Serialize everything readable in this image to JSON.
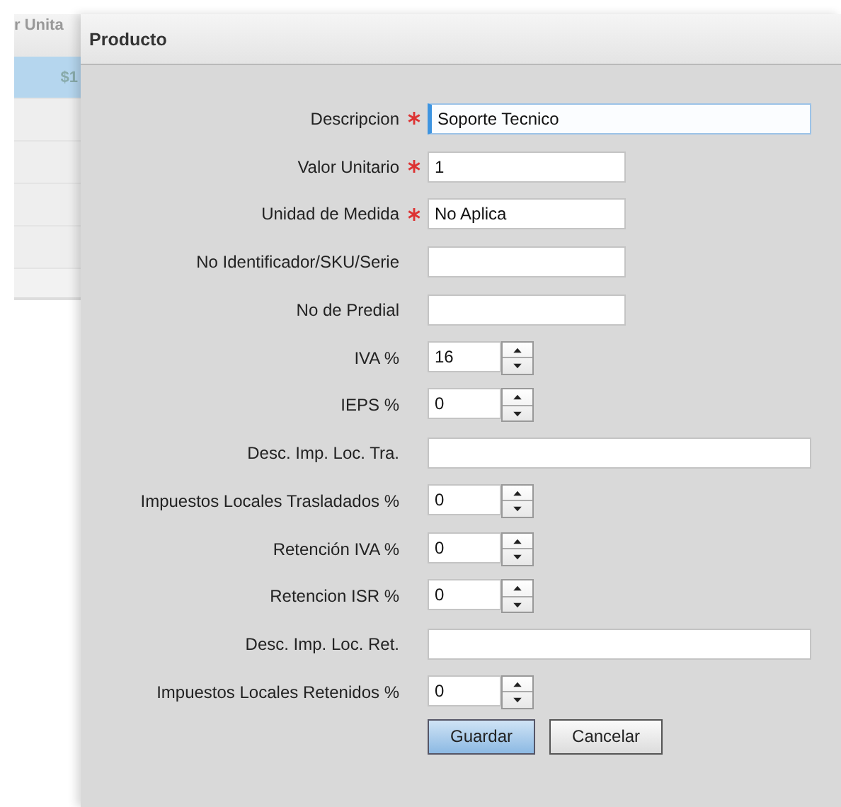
{
  "background_grid": {
    "column_header": "r Unita",
    "rows": [
      {
        "cell": "$1",
        "selected": true
      },
      {
        "selected": false
      },
      {
        "selected": false
      },
      {
        "selected": false
      },
      {
        "selected": false
      }
    ]
  },
  "dialog": {
    "title": "Producto",
    "fields": [
      {
        "label": "Descripcion",
        "required": true,
        "kind": "wide",
        "value": "Soporte Tecnico",
        "focused": true
      },
      {
        "label": "Valor Unitario",
        "required": true,
        "kind": "text",
        "value": "1",
        "focused": false
      },
      {
        "label": "Unidad de Medida",
        "required": true,
        "kind": "text",
        "value": "No Aplica",
        "focused": false
      },
      {
        "label": "No Identificador/SKU/Serie",
        "required": false,
        "kind": "text",
        "focused": false
      },
      {
        "label": "No de Predial",
        "required": false,
        "kind": "text",
        "focused": false
      },
      {
        "label": "IVA %",
        "required": false,
        "kind": "spinner",
        "value": "16",
        "focused": false
      },
      {
        "label": "IEPS %",
        "required": false,
        "kind": "spinner",
        "value": "0",
        "focused": false
      },
      {
        "label": "Desc. Imp. Loc. Tra.",
        "required": false,
        "kind": "wide",
        "focused": false
      },
      {
        "label": "Impuestos Locales Trasladados %",
        "required": false,
        "kind": "spinner",
        "value": "0",
        "focused": false
      },
      {
        "label": "Retención IVA %",
        "required": false,
        "kind": "spinner",
        "value": "0",
        "focused": false
      },
      {
        "label": "Retencion ISR %",
        "required": false,
        "kind": "spinner",
        "value": "0",
        "focused": false
      },
      {
        "label": "Desc. Imp. Loc. Ret.",
        "required": false,
        "kind": "wide",
        "focused": false
      },
      {
        "label": "Impuestos Locales Retenidos %",
        "required": false,
        "kind": "spinner",
        "value": "0",
        "focused": false
      }
    ],
    "buttons": [
      {
        "label": "Guardar",
        "kind": "primary"
      },
      {
        "label": "Cancelar",
        "kind": "default"
      }
    ]
  }
}
